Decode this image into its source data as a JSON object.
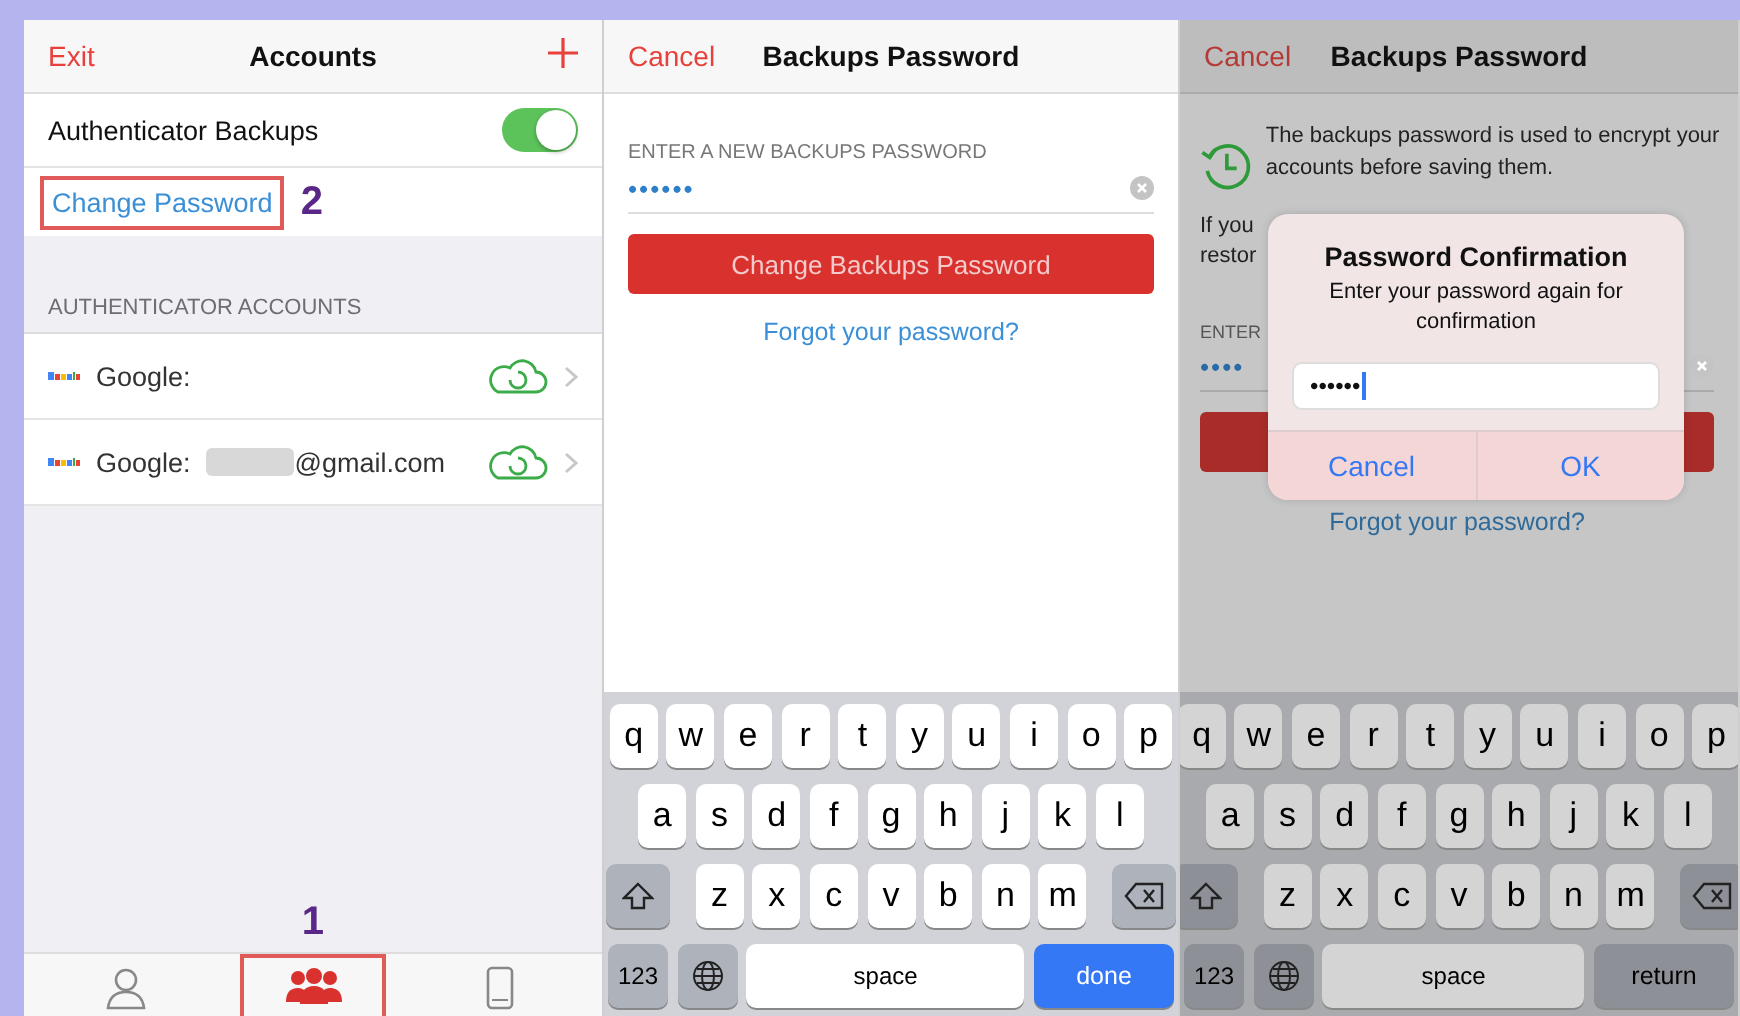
{
  "accounts_screen": {
    "nav": {
      "left": "Exit",
      "title": "Accounts"
    },
    "backup_toggle": {
      "label": "Authenticator Backups",
      "on": true
    },
    "change_password": {
      "label": "Change Password",
      "highlighted": true,
      "annotation": "2"
    },
    "section_header": "AUTHENTICATOR ACCOUNTS",
    "accounts": [
      {
        "name": "Google:",
        "redacted": false
      },
      {
        "name": "Google:",
        "redacted": true,
        "suffix": "@gmail.com"
      }
    ],
    "tabs": [
      {
        "kind": "person",
        "selected": false,
        "highlighted": false
      },
      {
        "kind": "group",
        "selected": true,
        "highlighted": true,
        "annotation": "1"
      },
      {
        "kind": "phone",
        "selected": false,
        "highlighted": false
      }
    ]
  },
  "password_screen": {
    "nav": {
      "left": "Cancel",
      "title": "Backups Password"
    },
    "field_label": "ENTER A NEW BACKUPS PASSWORD",
    "field_value": "••••••",
    "button": "Change Backups Password",
    "link": "Forgot your password?",
    "keyboard": {
      "dimmed": false,
      "rows": [
        {
          "keys": [
            {
              "kind": "char",
              "label": "q"
            },
            {
              "kind": "char",
              "label": "w"
            },
            {
              "kind": "char",
              "label": "e"
            },
            {
              "kind": "char",
              "label": "r"
            },
            {
              "kind": "char",
              "label": "t"
            },
            {
              "kind": "char",
              "label": "y"
            },
            {
              "kind": "char",
              "label": "u"
            },
            {
              "kind": "char",
              "label": "i"
            },
            {
              "kind": "char",
              "label": "o"
            },
            {
              "kind": "char",
              "label": "p"
            }
          ]
        },
        {
          "keys": [
            {
              "kind": "char",
              "label": "a"
            },
            {
              "kind": "char",
              "label": "s"
            },
            {
              "kind": "char",
              "label": "d"
            },
            {
              "kind": "char",
              "label": "f"
            },
            {
              "kind": "char",
              "label": "g"
            },
            {
              "kind": "char",
              "label": "h"
            },
            {
              "kind": "char",
              "label": "j"
            },
            {
              "kind": "char",
              "label": "k"
            },
            {
              "kind": "char",
              "label": "l"
            }
          ]
        },
        {
          "keys": [
            {
              "kind": "shift"
            },
            {
              "kind": "char",
              "label": "z"
            },
            {
              "kind": "char",
              "label": "x"
            },
            {
              "kind": "char",
              "label": "c"
            },
            {
              "kind": "char",
              "label": "v"
            },
            {
              "kind": "char",
              "label": "b"
            },
            {
              "kind": "char",
              "label": "n"
            },
            {
              "kind": "char",
              "label": "m"
            },
            {
              "kind": "delete"
            }
          ]
        },
        {
          "keys": [
            {
              "kind": "numbers",
              "label": "123"
            },
            {
              "kind": "globe"
            },
            {
              "kind": "space",
              "label": "space"
            },
            {
              "kind": "primary",
              "label": "done"
            }
          ]
        }
      ]
    }
  },
  "confirm_screen": {
    "nav": {
      "left": "Cancel",
      "title": "Backups Password"
    },
    "info": "The backups password is used to encrypt your accounts before saving them.",
    "hidden_lines": [
      "If you",
      "restor"
    ],
    "field_label": "ENTER",
    "field_value": "••••",
    "link": "Forgot your password?",
    "dialog": {
      "title": "Password Confirmation",
      "message": "Enter your password again for confirmation",
      "value": "••••••",
      "buttons": [
        "Cancel",
        "OK"
      ]
    },
    "keyboard": {
      "dimmed": true,
      "rows": [
        {
          "keys": [
            {
              "kind": "char",
              "label": "q"
            },
            {
              "kind": "char",
              "label": "w"
            },
            {
              "kind": "char",
              "label": "e"
            },
            {
              "kind": "char",
              "label": "r"
            },
            {
              "kind": "char",
              "label": "t"
            },
            {
              "kind": "char",
              "label": "y"
            },
            {
              "kind": "char",
              "label": "u"
            },
            {
              "kind": "char",
              "label": "i"
            },
            {
              "kind": "char",
              "label": "o"
            },
            {
              "kind": "char",
              "label": "p"
            }
          ]
        },
        {
          "keys": [
            {
              "kind": "char",
              "label": "a"
            },
            {
              "kind": "char",
              "label": "s"
            },
            {
              "kind": "char",
              "label": "d"
            },
            {
              "kind": "char",
              "label": "f"
            },
            {
              "kind": "char",
              "label": "g"
            },
            {
              "kind": "char",
              "label": "h"
            },
            {
              "kind": "char",
              "label": "j"
            },
            {
              "kind": "char",
              "label": "k"
            },
            {
              "kind": "char",
              "label": "l"
            }
          ]
        },
        {
          "keys": [
            {
              "kind": "shift"
            },
            {
              "kind": "char",
              "label": "z"
            },
            {
              "kind": "char",
              "label": "x"
            },
            {
              "kind": "char",
              "label": "c"
            },
            {
              "kind": "char",
              "label": "v"
            },
            {
              "kind": "char",
              "label": "b"
            },
            {
              "kind": "char",
              "label": "n"
            },
            {
              "kind": "char",
              "label": "m"
            },
            {
              "kind": "delete"
            }
          ]
        },
        {
          "keys": [
            {
              "kind": "numbers",
              "label": "123"
            },
            {
              "kind": "globe"
            },
            {
              "kind": "space",
              "label": "space"
            },
            {
              "kind": "action",
              "label": "return"
            }
          ]
        }
      ]
    }
  }
}
